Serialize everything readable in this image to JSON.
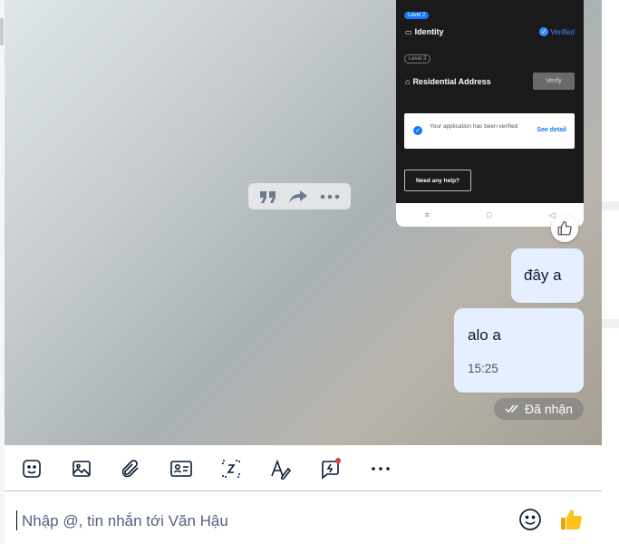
{
  "image_message": {
    "level_2_badge": "Level 2",
    "identity_label": "Identity",
    "verified_label": "Verified",
    "level_3_badge": "Level 3",
    "address_label": "Residential Address",
    "verify_button": "Verify",
    "notice_text": "Your application has been verified",
    "see_detail": "See detail",
    "help_button": "Need any help?",
    "nav_menu": "≡",
    "nav_home": "□",
    "nav_back": "◁"
  },
  "messages": [
    {
      "text": "đây a"
    },
    {
      "text": "alo a",
      "time": "15:25"
    }
  ],
  "status": {
    "label": "Đã nhận"
  },
  "composer": {
    "placeholder": "Nhập @, tin nhắn tới Văn Hậu"
  },
  "colors": {
    "bubble": "#e5efff",
    "accent": "#1479ff",
    "divider": "#b6c2d8"
  },
  "icons": [
    "quote-icon",
    "forward-icon",
    "more-icon",
    "like-icon",
    "sticker-icon",
    "image-icon",
    "attachment-icon",
    "contact-card-icon",
    "screenshot-icon",
    "text-format-icon",
    "quick-message-icon",
    "more-options-icon",
    "emoji-icon",
    "thumbs-up-icon"
  ]
}
